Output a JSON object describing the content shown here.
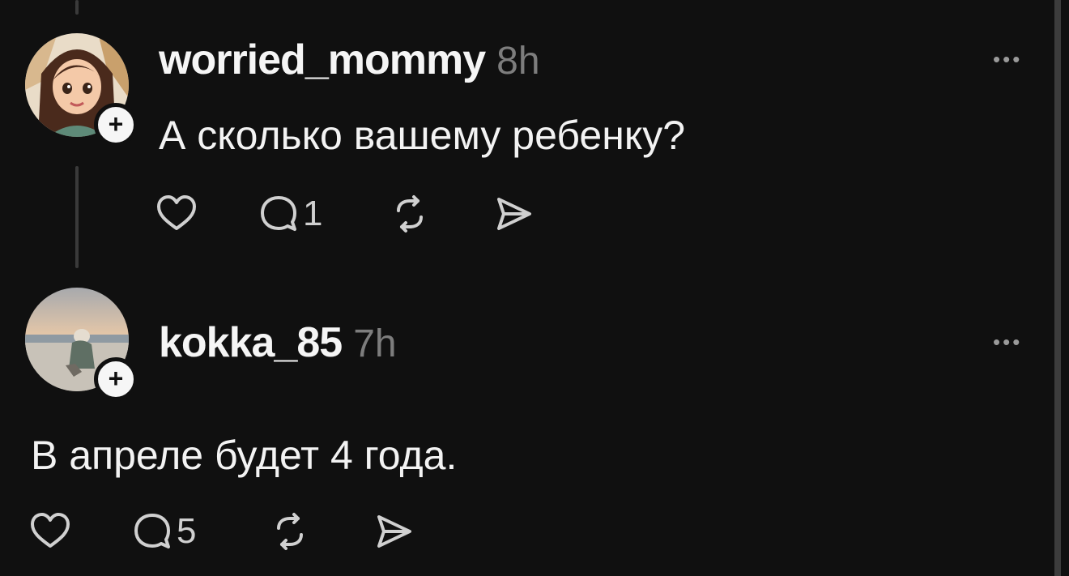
{
  "posts": [
    {
      "username": "worried_mommy",
      "time": "8h",
      "text": "А сколько вашему ребенку?",
      "replies": "1",
      "follow_symbol": "+",
      "more_symbol": "•••",
      "avatar": "cartoon-girl-avatar"
    },
    {
      "username": "kokka_85",
      "time": "7h",
      "text": "В апреле будет 4 года.",
      "replies": "5",
      "follow_symbol": "+",
      "more_symbol": "•••",
      "avatar": "beach-photo-avatar"
    }
  ],
  "icons": {
    "like": "heart-icon",
    "reply": "comment-icon",
    "repost": "repost-icon",
    "share": "send-icon"
  },
  "colors": {
    "background": "#101010",
    "text": "#f3f3f3",
    "muted": "#7d7d7d",
    "thread_line": "#3a3a3a"
  }
}
